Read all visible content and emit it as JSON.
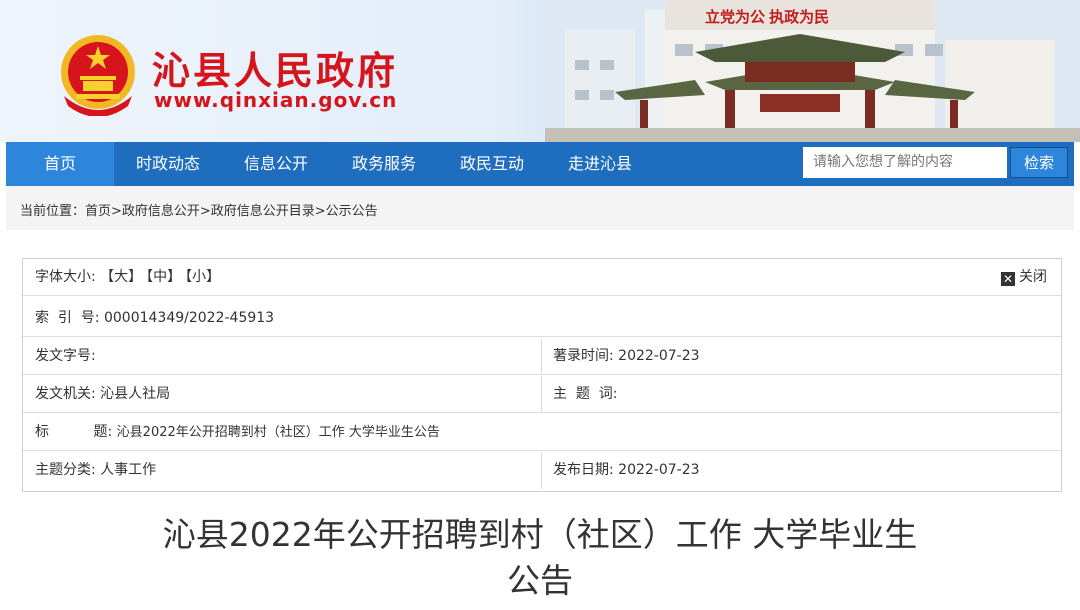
{
  "header": {
    "site_name": "沁县人民政府",
    "site_url": "www.qinxian.gov.cn",
    "building_slogan": "立党为公 执政为民"
  },
  "nav": {
    "items": [
      {
        "label": "首页"
      },
      {
        "label": "时政动态"
      },
      {
        "label": "信息公开"
      },
      {
        "label": "政务服务"
      },
      {
        "label": "政民互动"
      },
      {
        "label": "走进沁县"
      }
    ],
    "search_placeholder": "请输入您想了解的内容",
    "search_button": "检索"
  },
  "breadcrumb": {
    "text": "当前位置：首页>政府信息公开>政府信息公开目录>公示公告"
  },
  "info": {
    "font_size_label": "字体大小:",
    "font_large": "【大】",
    "font_medium": "【中】",
    "font_small": "【小】",
    "close_label": "关闭",
    "index_label": "索  引  号:",
    "index_value": "000014349/2022-45913",
    "doc_no_label": "发文字号:",
    "doc_no_value": "",
    "record_time_label": "著录时间:",
    "record_time_value": "2022-07-23",
    "issuer_label": "发文机关:",
    "issuer_value": "沁县人社局",
    "subject_words_label": "主  题  词:",
    "subject_words_value": "",
    "title_label": "标          题:",
    "title_value": "沁县2022年公开招聘到村（社区）工作 大学毕业生公告",
    "category_label": "主题分类:",
    "category_value": "人事工作",
    "publish_date_label": "发布日期:",
    "publish_date_value": "2022-07-23"
  },
  "article": {
    "title_line1": "沁县2022年公开招聘到村（社区）工作 大学毕业生",
    "title_line2": "公告"
  }
}
